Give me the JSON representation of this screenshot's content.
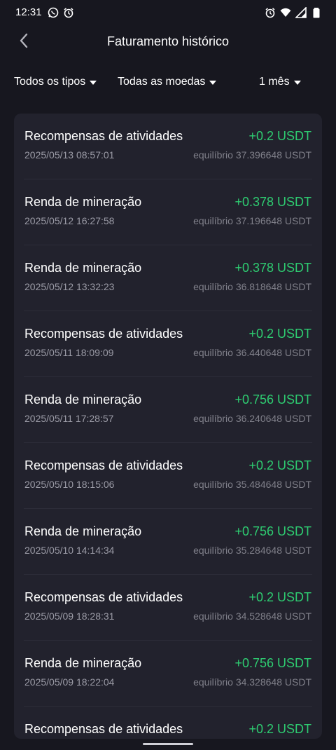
{
  "status_bar": {
    "time": "12:31",
    "left_icons": [
      "whatsapp-icon",
      "alarm-icon"
    ],
    "right_icons": [
      "alarm-icon",
      "wifi-icon",
      "signal-icon",
      "battery-icon"
    ]
  },
  "header": {
    "title": "Faturamento histórico",
    "back_icon": "chevron-left-icon"
  },
  "filters": {
    "type": "Todos os tipos",
    "currency": "Todas as moedas",
    "period": "1 mês"
  },
  "colors": {
    "background": "#17171f",
    "card": "#22222d",
    "positive": "#2ecc71",
    "secondary_text": "#9b9ba6"
  },
  "transactions": [
    {
      "title": "Recompensas de atividades",
      "date": "2025/05/13 08:57:01",
      "amount": "+0.2 USDT",
      "balance": "equilíbrio 37.396648 USDT"
    },
    {
      "title": "Renda de mineração",
      "date": "2025/05/12 16:27:58",
      "amount": "+0.378 USDT",
      "balance": "equilíbrio 37.196648 USDT"
    },
    {
      "title": "Renda de mineração",
      "date": "2025/05/12 13:32:23",
      "amount": "+0.378 USDT",
      "balance": "equilíbrio 36.818648 USDT"
    },
    {
      "title": "Recompensas de atividades",
      "date": "2025/05/11 18:09:09",
      "amount": "+0.2 USDT",
      "balance": "equilíbrio 36.440648 USDT"
    },
    {
      "title": "Renda de mineração",
      "date": "2025/05/11 17:28:57",
      "amount": "+0.756 USDT",
      "balance": "equilíbrio 36.240648 USDT"
    },
    {
      "title": "Recompensas de atividades",
      "date": "2025/05/10 18:15:06",
      "amount": "+0.2 USDT",
      "balance": "equilíbrio 35.484648 USDT"
    },
    {
      "title": "Renda de mineração",
      "date": "2025/05/10 14:14:34",
      "amount": "+0.756 USDT",
      "balance": "equilíbrio 35.284648 USDT"
    },
    {
      "title": "Recompensas de atividades",
      "date": "2025/05/09 18:28:31",
      "amount": "+0.2 USDT",
      "balance": "equilíbrio 34.528648 USDT"
    },
    {
      "title": "Renda de mineração",
      "date": "2025/05/09 18:22:04",
      "amount": "+0.756 USDT",
      "balance": "equilíbrio 34.328648 USDT"
    },
    {
      "title": "Recompensas de atividades",
      "date": "",
      "amount": "+0.2 USDT",
      "balance": ""
    }
  ]
}
